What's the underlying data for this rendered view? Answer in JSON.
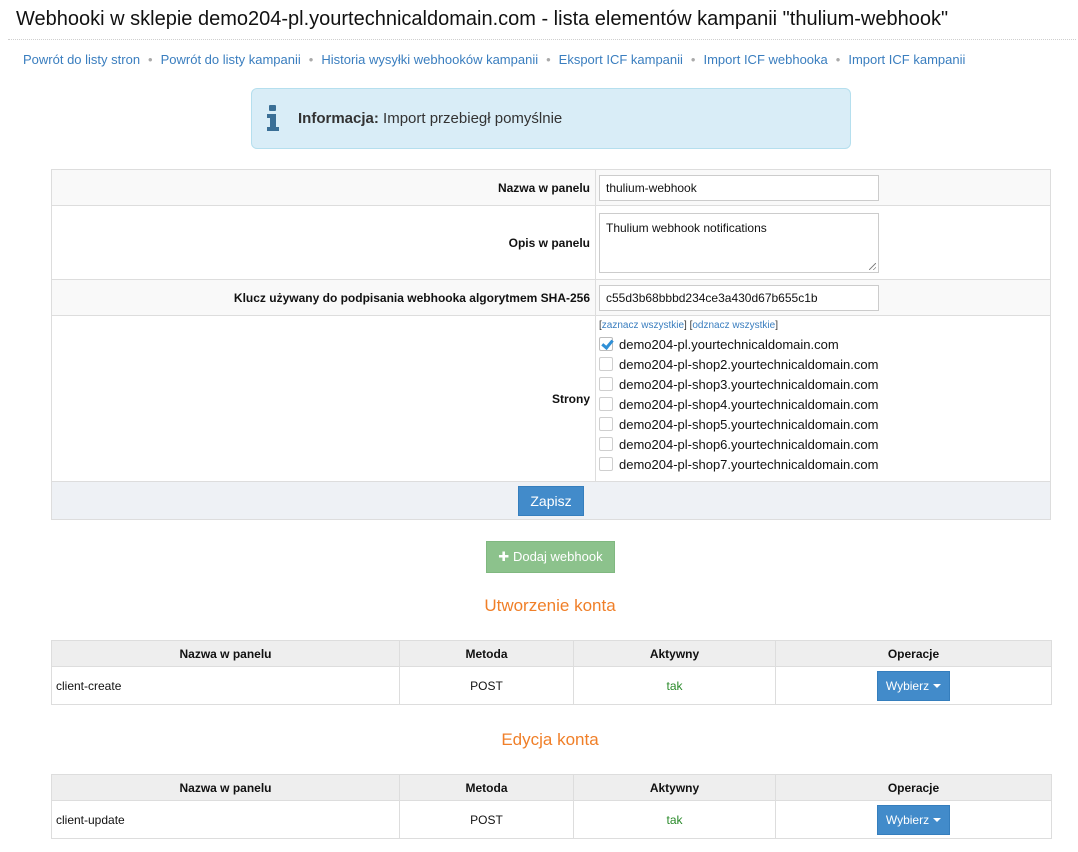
{
  "title": "Webhooki w sklepie demo204-pl.yourtechnicaldomain.com - lista elementów kampanii \"thulium-webhook\"",
  "breadcrumb": [
    "Powrót do listy stron",
    "Powrót do listy kampanii",
    "Historia wysyłki webhooków kampanii",
    "Eksport ICF kampanii",
    "Import ICF webhooka",
    "Import ICF kampanii"
  ],
  "info": {
    "label": "Informacja:",
    "message": "Import przebiegł pomyślnie",
    "icon": "info-icon",
    "color": "#d9edf7"
  },
  "form": {
    "name_label": "Nazwa w panelu",
    "name_value": "thulium-webhook",
    "desc_label": "Opis w panelu",
    "desc_value": "Thulium webhook notifications",
    "key_label": "Klucz używany do podpisania webhooka algorytmem SHA-256",
    "key_value": "c55d3b68bbbd234ce3a430d67b655c1b",
    "sites_label": "Strony",
    "select_all": "zaznacz wszystkie",
    "deselect_all": "odznacz wszystkie",
    "sites": [
      {
        "label": "demo204-pl.yourtechnicaldomain.com",
        "checked": true
      },
      {
        "label": "demo204-pl-shop2.yourtechnicaldomain.com",
        "checked": false
      },
      {
        "label": "demo204-pl-shop3.yourtechnicaldomain.com",
        "checked": false
      },
      {
        "label": "demo204-pl-shop4.yourtechnicaldomain.com",
        "checked": false
      },
      {
        "label": "demo204-pl-shop5.yourtechnicaldomain.com",
        "checked": false
      },
      {
        "label": "demo204-pl-shop6.yourtechnicaldomain.com",
        "checked": false
      },
      {
        "label": "demo204-pl-shop7.yourtechnicaldomain.com",
        "checked": false
      }
    ],
    "save_label": "Zapisz"
  },
  "add_webhook_label": "Dodaj webhook",
  "columns": {
    "name": "Nazwa w panelu",
    "method": "Metoda",
    "active": "Aktywny",
    "operations": "Operacje"
  },
  "sections": [
    {
      "title": "Utworzenie konta",
      "rows": [
        {
          "name": "client-create",
          "method": "POST",
          "active": "tak",
          "action": "Wybierz"
        }
      ]
    },
    {
      "title": "Edycja konta",
      "rows": [
        {
          "name": "client-update",
          "method": "POST",
          "active": "tak",
          "action": "Wybierz"
        }
      ]
    }
  ],
  "colors": {
    "link": "#3a7ebf",
    "primary": "#428bca",
    "success_button": "#8cc28c",
    "section_title": "#f07f28",
    "active_text": "#2a8a2a"
  }
}
